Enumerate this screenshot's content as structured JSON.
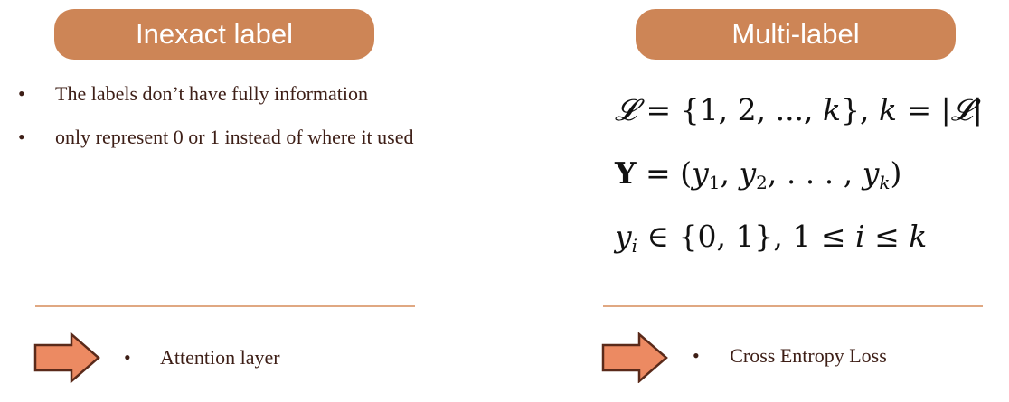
{
  "left_panel": {
    "header": "Inexact label",
    "bullets": [
      "The labels don’t have fully information",
      "only represent 0 or 1 instead of where it used"
    ],
    "arrow_item": "Attention layer"
  },
  "right_panel": {
    "header": "Multi-label",
    "equations": [
      "𝓛 = {1, 2, ..., k}, k = |𝓛|",
      "Y = (y1, y2, . . . , yk)",
      "yi ∈ {0, 1}, 1 ≤ i ≤ k"
    ],
    "arrow_item": "Cross Entropy Loss"
  },
  "bullet_glyph": "•",
  "colors": {
    "header_bg": "#cd8556",
    "arrow_fill": "#ec8a62",
    "arrow_stroke": "#5a2a1a",
    "divider": "#e0a882",
    "text": "#3d1e16"
  }
}
